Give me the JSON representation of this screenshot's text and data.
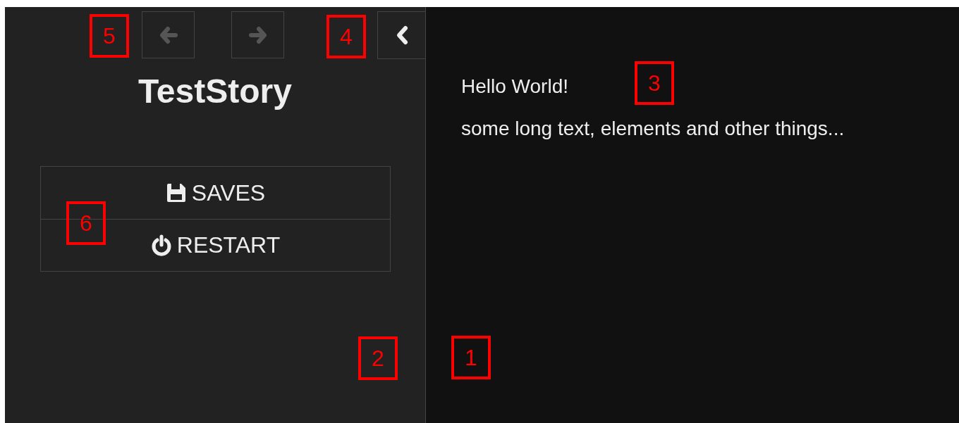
{
  "sidebar": {
    "history_buttons": [
      {
        "kind": "back",
        "disabled": true
      },
      {
        "kind": "forward",
        "disabled": true
      }
    ],
    "collapse_button": {
      "expanded": true
    },
    "story_title": "TestStory",
    "menu": [
      {
        "kind": "saves",
        "label": "SAVES"
      },
      {
        "kind": "restart",
        "label": "RESTART"
      }
    ]
  },
  "passage": {
    "lines": [
      "Hello World!",
      "some long text, elements and other things..."
    ]
  },
  "callouts": [
    "1",
    "2",
    "3",
    "4",
    "5",
    "6"
  ]
}
